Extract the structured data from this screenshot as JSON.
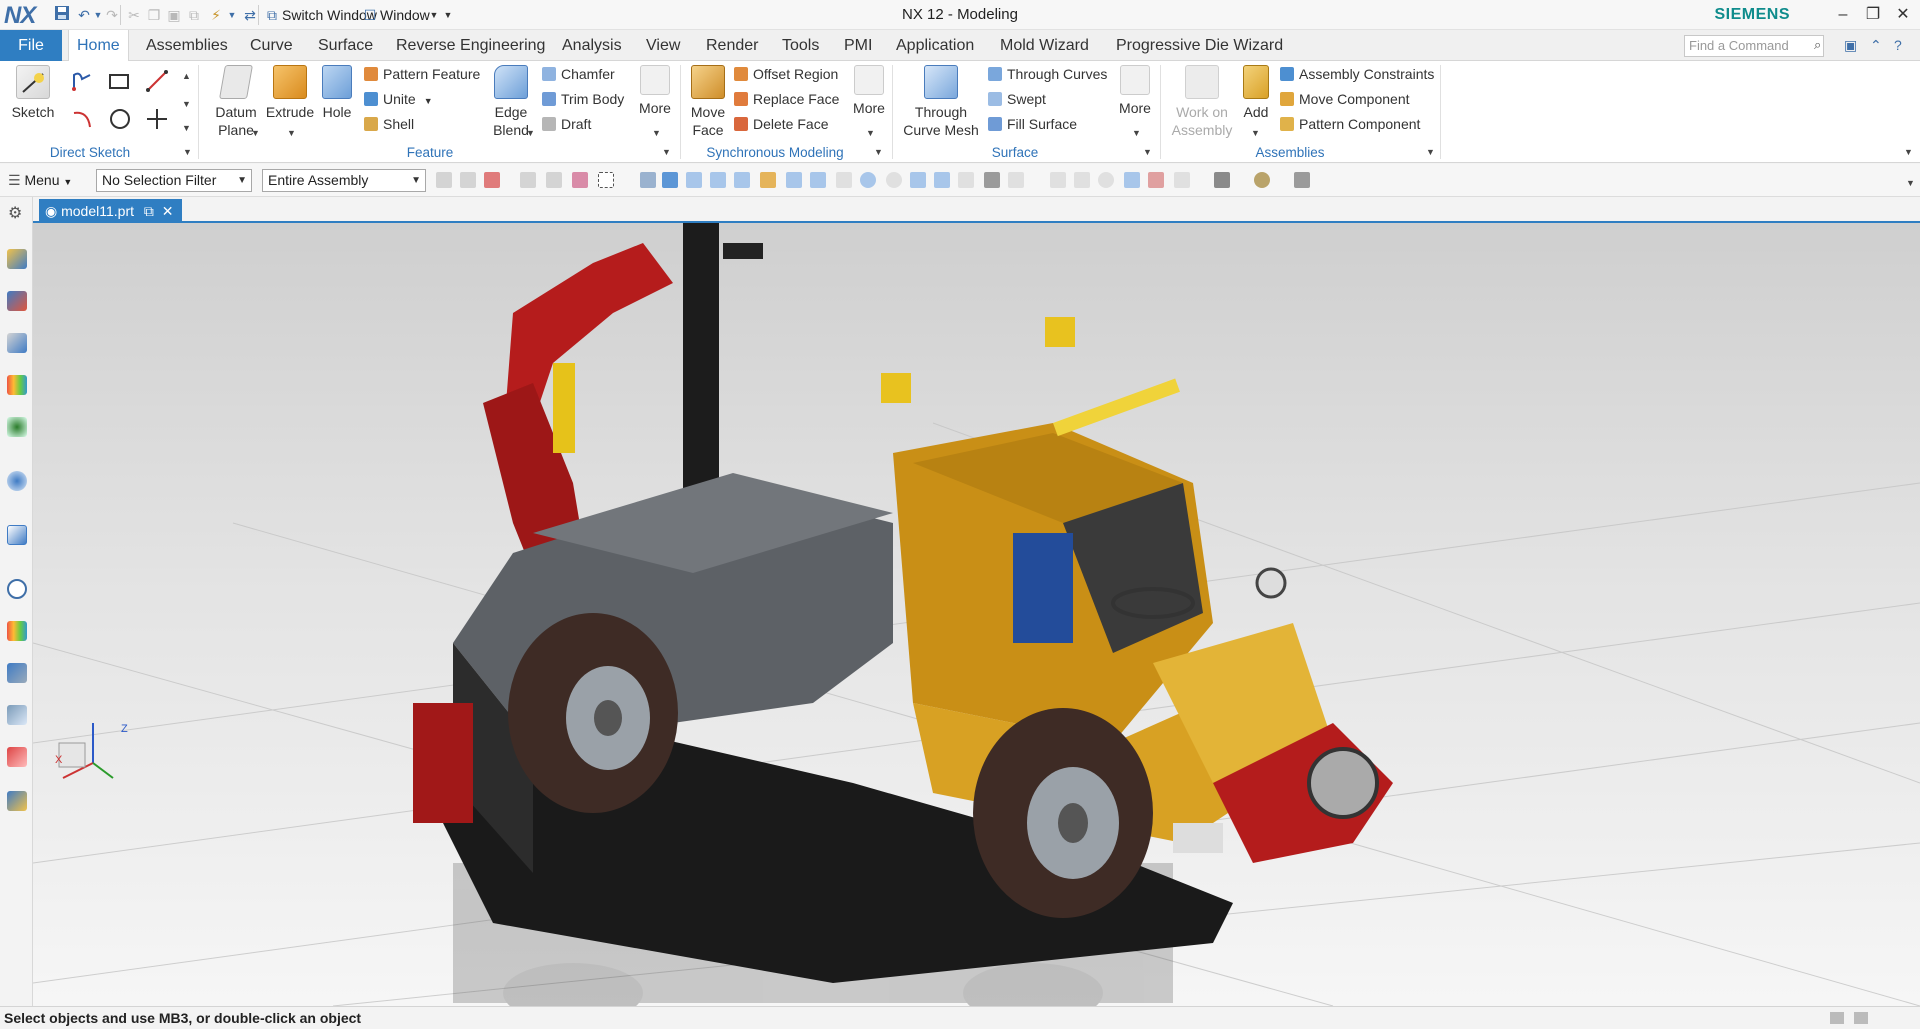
{
  "window": {
    "logo": "NX",
    "title": "NX 12 - Modeling",
    "brand": "SIEMENS",
    "switch_window": "Switch Window",
    "window_menu": "Window",
    "minimize": "–",
    "restore": "❐",
    "close": "✕"
  },
  "tabs": {
    "file": "File",
    "items": [
      "Home",
      "Assemblies",
      "Curve",
      "Surface",
      "Reverse Engineering",
      "Analysis",
      "View",
      "Render",
      "Tools",
      "PMI",
      "Application",
      "Mold Wizard",
      "Progressive Die Wizard"
    ],
    "active": "Home",
    "find_placeholder": "Find a Command"
  },
  "ribbon": {
    "direct_sketch": {
      "label": "Direct Sketch",
      "sketch": "Sketch"
    },
    "feature": {
      "label": "Feature",
      "datum_plane_1": "Datum",
      "datum_plane_2": "Plane",
      "extrude": "Extrude",
      "hole": "Hole",
      "pattern_feature": "Pattern Feature",
      "unite": "Unite",
      "shell": "Shell",
      "edge_blend_1": "Edge",
      "edge_blend_2": "Blend",
      "chamfer": "Chamfer",
      "trim_body": "Trim Body",
      "draft": "Draft",
      "more": "More"
    },
    "sync": {
      "label": "Synchronous Modeling",
      "move_face_1": "Move",
      "move_face_2": "Face",
      "offset_region": "Offset Region",
      "replace_face": "Replace Face",
      "delete_face": "Delete Face",
      "more": "More"
    },
    "surface": {
      "label": "Surface",
      "through_curve_mesh_1": "Through",
      "through_curve_mesh_2": "Curve Mesh",
      "through_curves": "Through Curves",
      "swept": "Swept",
      "fill_surface": "Fill Surface",
      "more": "More"
    },
    "assemblies": {
      "label": "Assemblies",
      "work_on_1": "Work on",
      "work_on_2": "Assembly",
      "add": "Add",
      "assembly_constraints": "Assembly Constraints",
      "move_component": "Move Component",
      "pattern_component": "Pattern Component"
    }
  },
  "toolbar": {
    "menu": "Menu",
    "selection_filter": "No Selection Filter",
    "scope": "Entire Assembly"
  },
  "document": {
    "tab": "model11.prt"
  },
  "triad": {
    "z": "Z",
    "x": "X"
  },
  "status": {
    "message": "Select objects and use MB3, or double-click an object"
  },
  "colors": {
    "accent": "#2f7ec2",
    "brand": "#0f8c8c",
    "group_label": "#2f73b8"
  }
}
